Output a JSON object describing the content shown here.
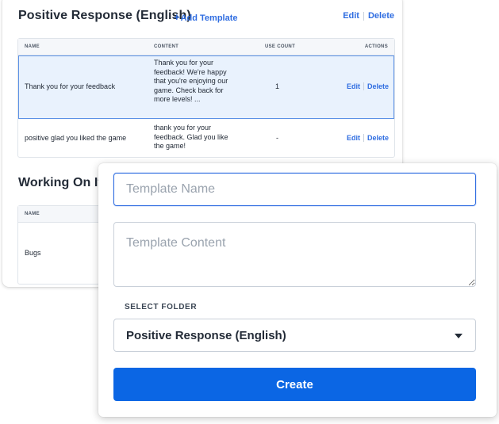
{
  "folders": [
    {
      "title": "Positive Response (English)",
      "add_template": "Add Template",
      "add_template_plus": "+",
      "edit": "Edit",
      "delete": "Delete",
      "columns": {
        "name": "NAME",
        "content": "CONTENT",
        "use_count": "USE COUNT",
        "actions": "ACTIONS"
      },
      "rows": [
        {
          "name": "Thank you for your feedback",
          "content": [
            "Thank you for your",
            "feedback! We're happy",
            "that you're enjoying our",
            "game. Check back for",
            "more levels! ..."
          ],
          "use_count": "1",
          "edit": "Edit",
          "delete": "Delete"
        },
        {
          "name": "positive glad you liked the game",
          "content": [
            "thank you for your",
            "feedback. Glad you like",
            "the game!"
          ],
          "use_count": "-",
          "edit": "Edit",
          "delete": "Delete"
        }
      ]
    },
    {
      "title": "Working On It (E",
      "columns": {
        "name": "NAME"
      },
      "rows": [
        {
          "name": "Bugs"
        }
      ]
    }
  ],
  "form": {
    "name_placeholder": "Template Name",
    "content_placeholder": "Template Content",
    "folder_label": "SELECT FOLDER",
    "folder_value": "Positive Response (English)",
    "create_label": "Create"
  },
  "colors": {
    "accent": "#2f6de1",
    "primary_button": "#0b66e4",
    "selected_row": "#e9f2fd"
  }
}
